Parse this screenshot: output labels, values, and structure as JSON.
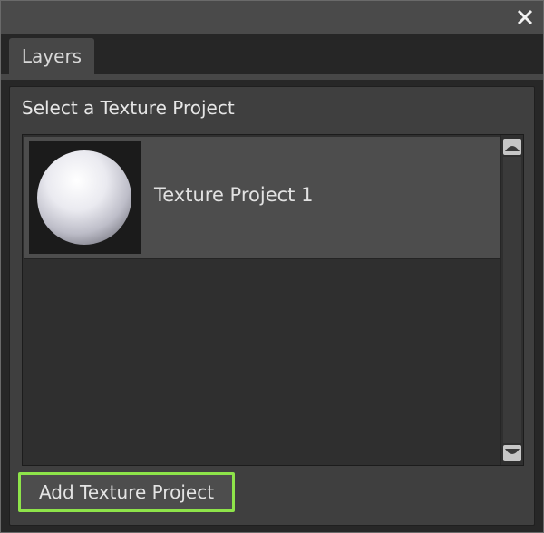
{
  "window": {
    "close_icon": "close-icon"
  },
  "tabs": [
    {
      "label": "Layers",
      "active": true
    }
  ],
  "panel": {
    "heading": "Select a Texture Project",
    "projects": [
      {
        "name": "Texture Project 1",
        "thumbnail_icon": "sphere-thumbnail"
      }
    ],
    "add_button_label": "Add Texture Project"
  },
  "colors": {
    "highlight": "#8ee44a",
    "titlebar": "#4a4a4a",
    "panel": "#3f3f3f"
  }
}
